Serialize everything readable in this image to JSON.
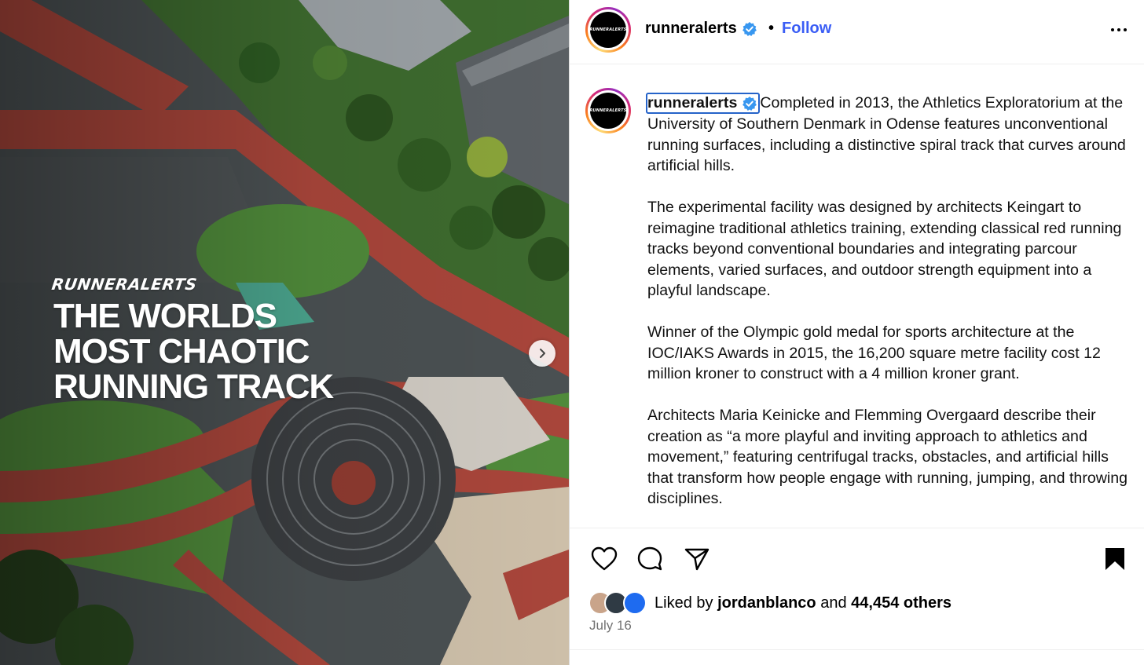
{
  "media": {
    "brand_script": "RUNNERALERTS",
    "headline_lines": [
      "THE WORLDS",
      "MOST CHAOTIC",
      "RUNNING TRACK"
    ]
  },
  "header": {
    "username": "runneralerts",
    "separator": "•",
    "follow_label": "Follow",
    "avatar_text": "RUNNERALERTS"
  },
  "caption": {
    "username": "runneralerts",
    "paragraphs": [
      "Completed in 2013, the Athletics Exploratorium at the University of Southern Denmark in Odense features unconventional running surfaces, including a distinctive spiral track that curves around artificial hills.",
      "The experimental facility was designed by architects Keingart to reimagine traditional athletics training, extending classical red running tracks beyond conventional boundaries and integrating parcour elements, varied surfaces, and outdoor strength equipment into a playful landscape.",
      "Winner of the Olympic gold medal for sports architecture at the IOC/IAKS Awards in 2015, the 16,200 square metre facility cost 12 million kroner to construct with a 4 million kroner grant.",
      "Architects Maria Keinicke and Flemming Overgaard describe their creation as “a more playful and inviting approach to athletics and movement,” featuring centrifugal tracks, obstacles, and artificial hills that transform how people engage with running, jumping, and throwing disciplines."
    ]
  },
  "likes": {
    "prefix": "Liked by",
    "user": "jordanblanco",
    "middle": "and",
    "count": "44,454 others"
  },
  "date": "July 16",
  "colors": {
    "follow": "#3a5df5",
    "verified": "#3897f0",
    "track_red": "#a8453a",
    "grass": "#4f8a3a"
  }
}
